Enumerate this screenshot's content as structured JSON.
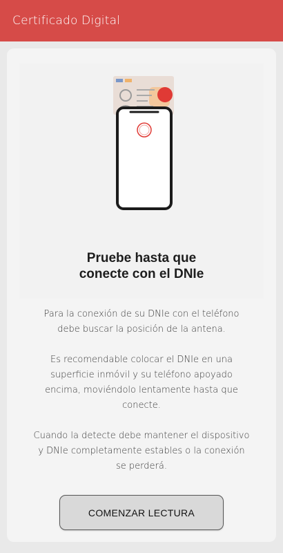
{
  "appbar": {
    "title": "Certificado Digital"
  },
  "illustration": {
    "icon": "phone-over-dnie-card-icon",
    "accent_color": "#e03a35"
  },
  "headline": {
    "line1": "Pruebe hasta que",
    "line2": "conecte con el DNIe"
  },
  "instructions": {
    "p1": [
      "Para la conexión de su DNIe con el teléfono",
      "debe buscar la posición de la antena."
    ],
    "p2": [
      "Es recomendable colocar el DNIe en una",
      "superficie inmóvil y su teléfono apoyado",
      "encima, moviéndolo lentamente hasta que",
      "conecte."
    ],
    "p3": [
      "Cuando la detecte debe mantener el dispositivo",
      "y DNIe completamente estables o la conexión",
      "se perderá."
    ]
  },
  "actions": {
    "start_label": "COMENZAR LECTURA"
  },
  "colors": {
    "appbar": "#d64b48",
    "background": "#e9e9e9",
    "card": "#f4f4f4"
  }
}
